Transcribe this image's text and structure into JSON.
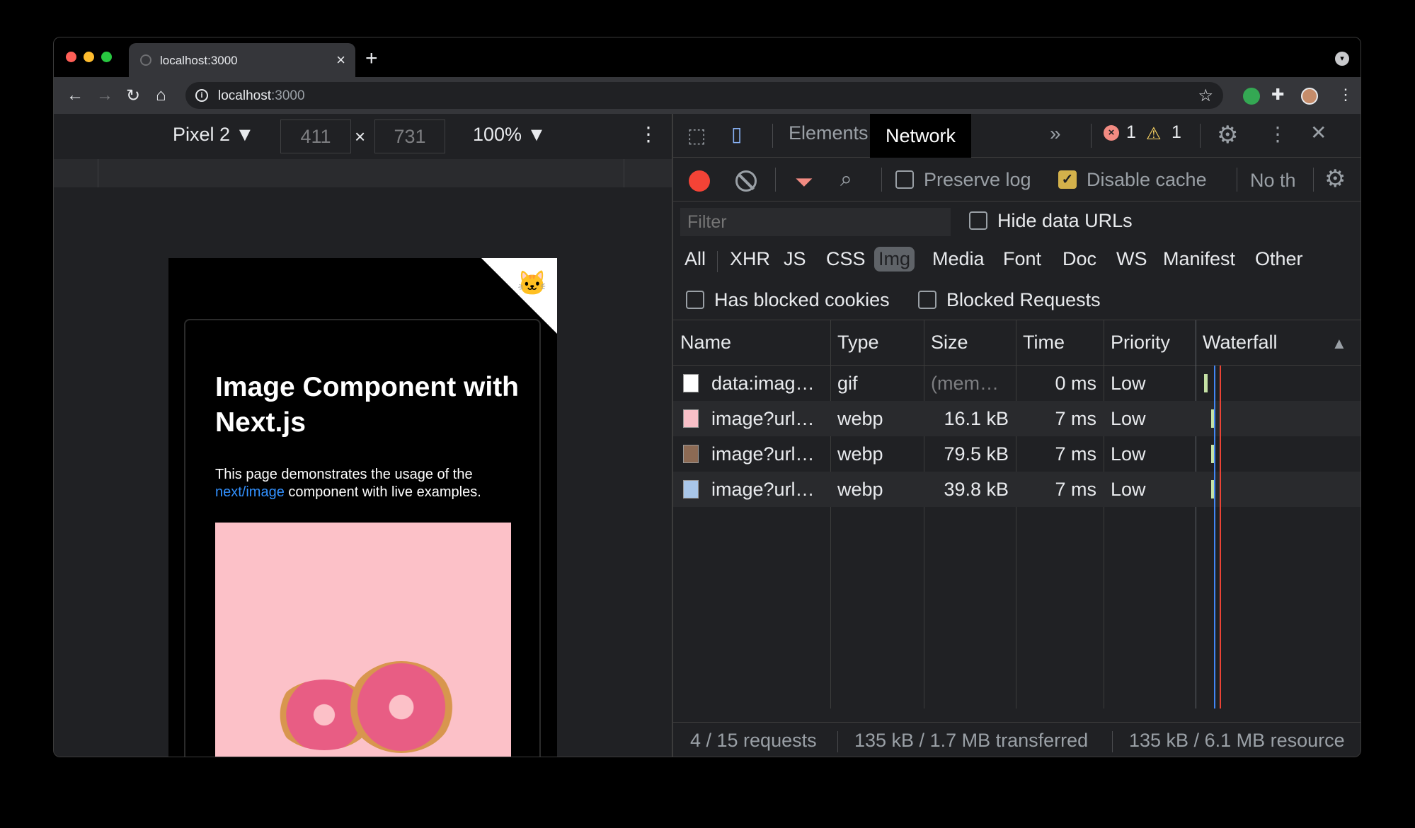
{
  "browser": {
    "tab_title": "localhost:3000",
    "url_host": "localhost",
    "url_port": ":3000"
  },
  "device_toolbar": {
    "device": "Pixel 2",
    "width": "411",
    "height": "731",
    "zoom": "100%"
  },
  "page": {
    "heading": "Image Component with Next.js",
    "desc_before": "This page demonstrates the usage of the ",
    "desc_link": "next/image",
    "desc_after": " component with live examples."
  },
  "devtools": {
    "tabs": [
      "Elements",
      "Network"
    ],
    "error_count": "1",
    "warning_count": "1",
    "preserve_log": "Preserve log",
    "disable_cache": "Disable cache",
    "throttle": "No th",
    "filter_placeholder": "Filter",
    "hide_data_urls": "Hide data URLs",
    "types": [
      "All",
      "XHR",
      "JS",
      "CSS",
      "Img",
      "Media",
      "Font",
      "Doc",
      "WS",
      "Manifest",
      "Other"
    ],
    "has_blocked_cookies": "Has blocked cookies",
    "blocked_requests": "Blocked Requests",
    "columns": [
      "Name",
      "Type",
      "Size",
      "Time",
      "Priority",
      "Waterfall"
    ],
    "rows": [
      {
        "name": "data:imag…",
        "type": "gif",
        "size": "(mem…",
        "time": "0 ms",
        "priority": "Low"
      },
      {
        "name": "image?url…",
        "type": "webp",
        "size": "16.1 kB",
        "time": "7 ms",
        "priority": "Low"
      },
      {
        "name": "image?url…",
        "type": "webp",
        "size": "79.5 kB",
        "time": "7 ms",
        "priority": "Low"
      },
      {
        "name": "image?url…",
        "type": "webp",
        "size": "39.8 kB",
        "time": "7 ms",
        "priority": "Low"
      }
    ],
    "status": {
      "requests": "4 / 15 requests",
      "transferred": "135 kB / 1.7 MB transferred",
      "resources": "135 kB / 6.1 MB resource"
    }
  },
  "colors": {
    "record": "#f44336",
    "link": "#3291ff",
    "donut_bg": "#fcc1c8",
    "checkbox_checked": "#d3b14b"
  }
}
